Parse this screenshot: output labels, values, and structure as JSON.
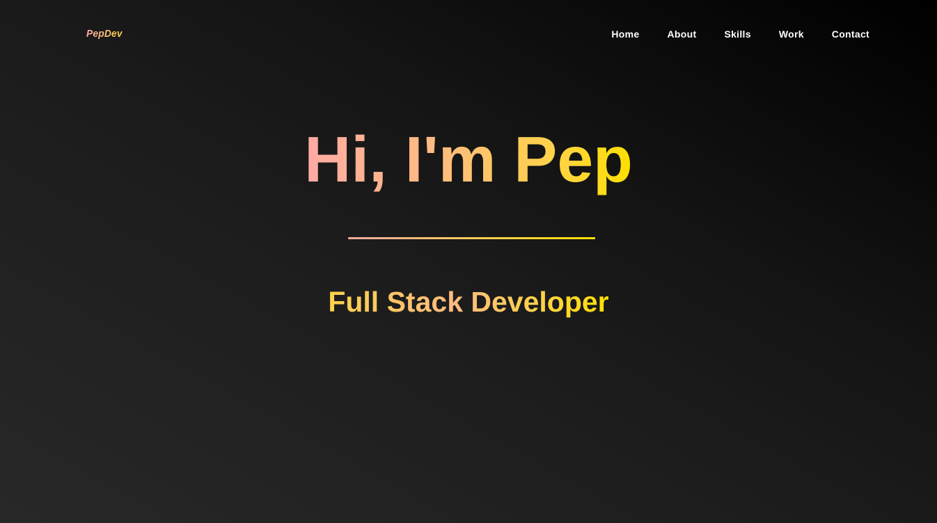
{
  "navbar": {
    "logo": "PepDev",
    "links": [
      {
        "label": "Home"
      },
      {
        "label": "About"
      },
      {
        "label": "Skills"
      },
      {
        "label": "Work"
      },
      {
        "label": "Contact"
      }
    ]
  },
  "hero": {
    "title": "Hi, I'm Pep",
    "subtitle": "Full Stack Developer"
  },
  "colors": {
    "gradient_start": "#ffaaa5",
    "gradient_end": "#ffe000",
    "background_dark": "#000000",
    "background_light": "#282828",
    "nav_text": "#ffffff"
  }
}
